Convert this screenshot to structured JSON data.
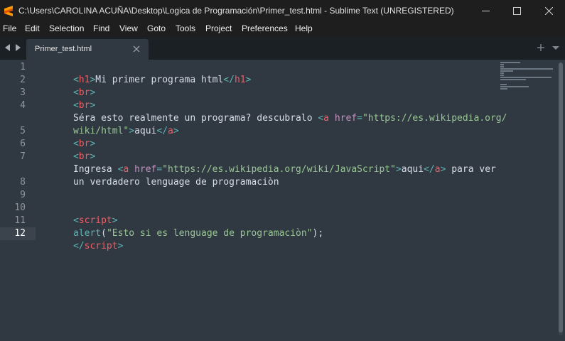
{
  "window": {
    "title": "C:\\Users\\CAROLINA ACUÑA\\Desktop\\Logica de Programación\\Primer_test.html - Sublime Text (UNREGISTERED)",
    "app_icon": "sublime-text-icon",
    "controls": [
      "minimize-icon",
      "maximize-icon",
      "close-icon"
    ]
  },
  "menu": {
    "items": [
      {
        "label": "File"
      },
      {
        "label": "Edit"
      },
      {
        "label": "Selection"
      },
      {
        "label": "Find"
      },
      {
        "label": "View"
      },
      {
        "label": "Goto"
      },
      {
        "label": "Tools"
      },
      {
        "label": "Project"
      },
      {
        "label": "Preferences"
      },
      {
        "label": "Help"
      }
    ]
  },
  "tabs": {
    "active": {
      "label": "Primer_test.html"
    },
    "nav_icons": [
      "triangle-left-icon",
      "triangle-right-icon"
    ],
    "right_icons": [
      "plus-icon",
      "chevron-down-icon"
    ]
  },
  "editor": {
    "line_numbers": [
      "1",
      "2",
      "3",
      "4",
      "",
      "5",
      "6",
      "7",
      "",
      "8",
      "9",
      "10",
      "11",
      "12"
    ],
    "active_line": "12",
    "lines": {
      "l1": {
        "t1": "<",
        "t2": "h1",
        "t3": ">",
        "t4": "Mi primer programa html",
        "t5": "</",
        "t6": "h1",
        "t7": ">"
      },
      "l2": {
        "t1": "<",
        "t2": "br",
        "t3": ">"
      },
      "l3": {
        "t1": "<",
        "t2": "br",
        "t3": ">"
      },
      "l4": {
        "t1": "Séra esto realmente un programa? descubralo ",
        "t2": "<",
        "t3": "a",
        "t4": " ",
        "t5": "href",
        "t6": "=",
        "t7": "\"https://es.wikipedia.org/"
      },
      "l4b": {
        "t1": "wiki/html\"",
        "t2": ">",
        "t3": "aqui",
        "t4": "</",
        "t5": "a",
        "t6": ">"
      },
      "l5": {
        "t1": "<",
        "t2": "br",
        "t3": ">"
      },
      "l6": {
        "t1": "<",
        "t2": "br",
        "t3": ">"
      },
      "l7": {
        "t1": "Ingresa ",
        "t2": "<",
        "t3": "a",
        "t4": " ",
        "t5": "href",
        "t6": "=",
        "t7": "\"https://es.wikipedia.org/wiki/JavaScript\"",
        "t8": ">",
        "t9": "aqui",
        "t10": "</",
        "t11": "a",
        "t12": ">",
        "t13": " para ver"
      },
      "l7b": {
        "t1": "un verdadero lenguage de programaciòn"
      },
      "l10": {
        "t1": "<",
        "t2": "script",
        "t3": ">"
      },
      "l11": {
        "t1": "alert",
        "t2": "(",
        "t3": "\"Esto si es lenguage de programaciòn\"",
        "t4": ");"
      },
      "l12": {
        "t1": "</",
        "t2": "script",
        "t3": ">"
      }
    }
  },
  "colors": {
    "background": "#303841",
    "titlebar": "#1e1e1e",
    "tabbar": "#1b2024",
    "tag": "#ec5f67",
    "punctuation": "#5fb3b3",
    "attribute": "#c594c5",
    "string": "#99c794",
    "text": "#d8dee9",
    "accent_icon": "#ff9800"
  }
}
